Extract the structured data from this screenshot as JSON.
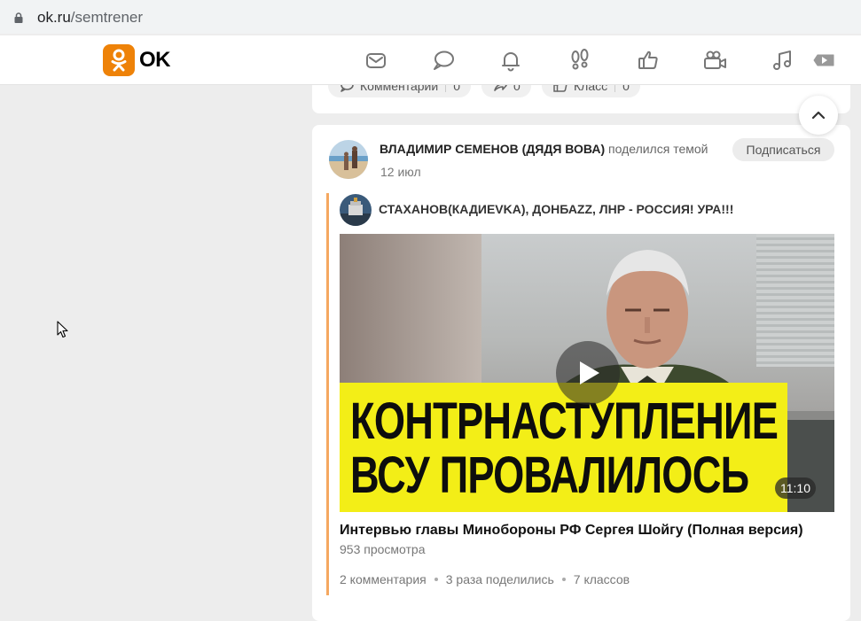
{
  "browser": {
    "url_host": "ok.ru",
    "url_path": "/semtrener"
  },
  "header": {
    "logo_text": "OK",
    "icons": [
      "mail-icon",
      "chat-icon",
      "bell-icon",
      "guests-icon",
      "like-icon",
      "video-camera-icon",
      "music-icon",
      "video-play-icon"
    ]
  },
  "prev_post": {
    "comments_label": "Комментарии",
    "comments_count": "0",
    "shares_count": "0",
    "likes_label": "Класс",
    "likes_count": "0"
  },
  "post": {
    "author": "ВЛАДИМИР СЕМЕНОВ (ДЯДЯ ВОВА)",
    "action": "поделился темой",
    "date": "12 июл",
    "subscribe_label": "Подписаться",
    "group_name": "СТАХАНОВ(КАДИЕVKA), ДОНБАZZ, ЛНР - РОССИЯ! УРА!!!",
    "video": {
      "banner_line1": "КОНТРНАСТУПЛЕНИЕ",
      "banner_line2": "ВСУ ПРОВАЛИЛОСЬ",
      "duration": "11:10",
      "title": "Интервью главы Минобороны РФ Сергея Шойгу (Полная версия)",
      "views": "953 просмотра"
    },
    "stats": {
      "comments": "2 комментария",
      "shares": "3 раза поделились",
      "likes": "7 классов"
    }
  },
  "colors": {
    "brand": "#ee8208",
    "quote_bar": "#f5a860",
    "banner": "#f3ee17"
  }
}
